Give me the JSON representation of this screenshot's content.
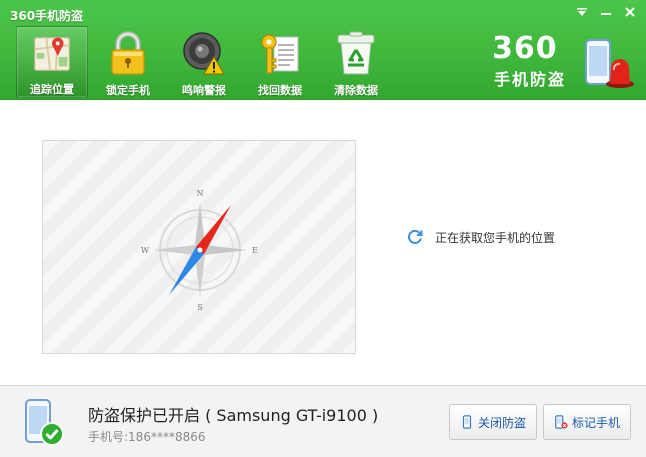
{
  "window": {
    "title": "360手机防盗",
    "controls": [
      "menu",
      "minimize",
      "close"
    ]
  },
  "toolbar": {
    "items": [
      {
        "label": "追踪位置",
        "icon": "map-icon",
        "active": true
      },
      {
        "label": "锁定手机",
        "icon": "padlock-icon",
        "active": false
      },
      {
        "label": "鸣响警报",
        "icon": "speaker-alarm-icon",
        "active": false
      },
      {
        "label": "找回数据",
        "icon": "key-document-icon",
        "active": false
      },
      {
        "label": "清除数据",
        "icon": "recycle-bin-icon",
        "active": false
      }
    ]
  },
  "brand": {
    "number": "360",
    "subtitle": "手机防盗",
    "icon": "phone-siren-icon"
  },
  "map": {
    "compass_letters": {
      "n": "N",
      "s": "S",
      "e": "E",
      "w": "W"
    },
    "icon": "compass-icon"
  },
  "status": {
    "text": "正在获取您手机的位置",
    "icon": "refresh-spinner-icon"
  },
  "footer": {
    "protection_text": "防盗保护已开启 ( Samsung GT-i9100 )",
    "phone_number_text": "手机号:186****8866",
    "close_button": "关闭防盗",
    "mark_button": "标记手机"
  },
  "colors": {
    "header_green": "#3fb83c",
    "accent_blue": "#1a5aa8",
    "check_green": "#2fae2f"
  }
}
